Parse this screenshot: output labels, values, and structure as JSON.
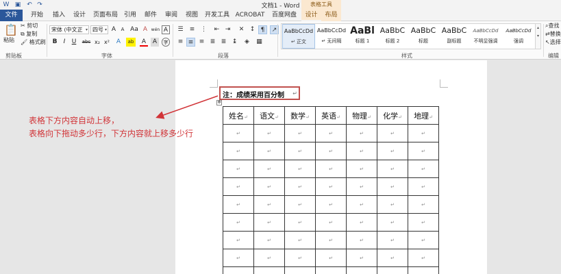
{
  "title_bar": {
    "doc_title": "文档1 - Word",
    "context_tab_group": "表格工具",
    "quick_access": [
      "word-app-icon",
      "save-icon",
      "undo-icon",
      "redo-icon"
    ]
  },
  "tabs": [
    {
      "label": "文件"
    },
    {
      "label": "开始"
    },
    {
      "label": "插入"
    },
    {
      "label": "设计"
    },
    {
      "label": "页面布局"
    },
    {
      "label": "引用"
    },
    {
      "label": "邮件"
    },
    {
      "label": "审阅"
    },
    {
      "label": "视图"
    },
    {
      "label": "开发工具"
    },
    {
      "label": "ACROBAT"
    },
    {
      "label": "百度网盘"
    },
    {
      "label": "设计"
    },
    {
      "label": "布局"
    }
  ],
  "ribbon": {
    "clipboard": {
      "paste": "粘贴",
      "cut": "剪切",
      "copy": "复制",
      "format_painter": "格式刷",
      "group_label": "剪贴板"
    },
    "font": {
      "font_name": "宋体 (中文正",
      "font_size": "四号",
      "grow": "A",
      "shrink": "A",
      "case": "Aa",
      "clear": "A",
      "phonetic": "wén",
      "border_char": "A",
      "bold": "B",
      "italic": "I",
      "underline": "U",
      "strike": "abc",
      "subscript": "x₂",
      "superscript": "x²",
      "effects": "A",
      "highlight": "ab",
      "color": "A",
      "shading": "A",
      "enclose": "字",
      "group_label": "字体"
    },
    "paragraph": {
      "group_label": "段落"
    },
    "styles": {
      "items": [
        {
          "preview": "AaBbCcDd",
          "name": "↵ 正文"
        },
        {
          "preview": "AaBbCcDd",
          "name": "↵ 无间隔"
        },
        {
          "preview": "AaBl",
          "name": "标题 1"
        },
        {
          "preview": "AaBbC",
          "name": "标题 2"
        },
        {
          "preview": "AaBbC",
          "name": "标题"
        },
        {
          "preview": "AaBbC",
          "name": "副标题"
        },
        {
          "preview": "AaBbCcDd",
          "name": "不明显强调"
        },
        {
          "preview": "AaBbCcDd",
          "name": "强调"
        }
      ],
      "group_label": "样式"
    },
    "editing": {
      "find": "查找",
      "replace": "替换",
      "select": "选择",
      "group_label": "编辑"
    }
  },
  "document": {
    "note": "注：成绩采用百分制",
    "paragraph_mark": "↵",
    "annotation_lines": [
      "表格下方内容自动上移，",
      "表格向下拖动多少行，下方内容就上移多少行"
    ],
    "table": {
      "headers": [
        "姓名",
        "语文",
        "数学",
        "英语",
        "物理",
        "化学",
        "地理"
      ],
      "empty_rows": 9,
      "cell_mark": "↵"
    }
  },
  "colors": {
    "word_blue": "#2b579a",
    "context_tab": "#fbe8d0",
    "annotation_red": "#d13438"
  }
}
